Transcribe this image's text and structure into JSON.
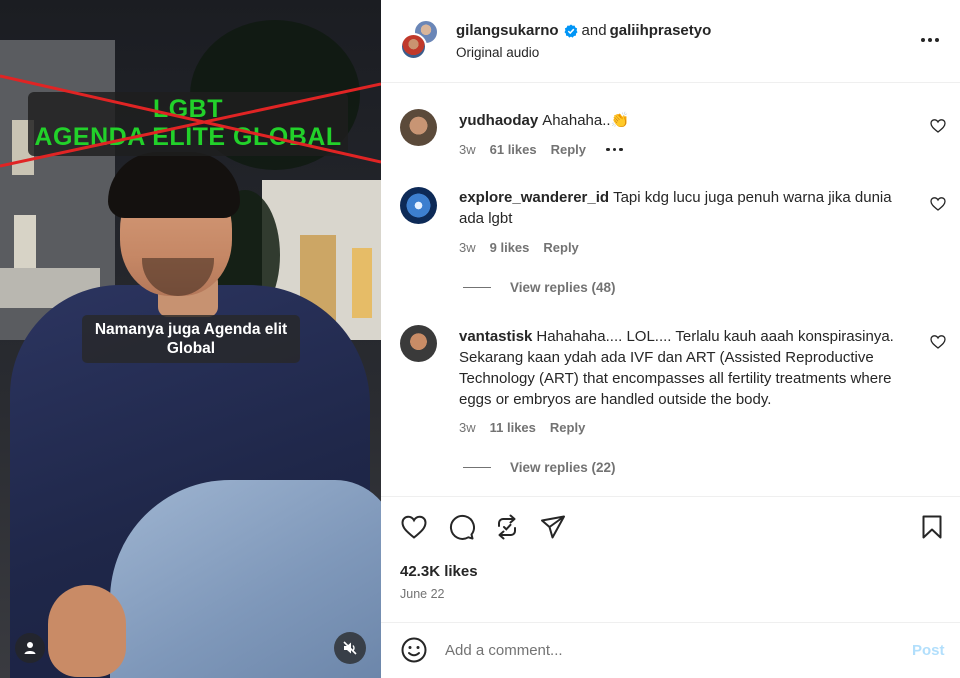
{
  "video": {
    "overlay_title_line1": "LGBT",
    "overlay_title_line2": "AGENDA ELITE GLOBAL",
    "caption": "Namanya juga Agenda elit Global"
  },
  "header": {
    "username_primary": "gilangsukarno",
    "connector": "and",
    "username_collab": "galiihprasetyo",
    "audio": "Original audio",
    "verified": true
  },
  "comments": [
    {
      "username": "yudhaoday",
      "text": "Ahahaha..👏",
      "time": "3w",
      "likes": "61 likes",
      "reply_label": "Reply"
    },
    {
      "username": "explore_wanderer_id",
      "text": "Tapi kdg lucu juga penuh warna jika dunia ada lgbt",
      "time": "3w",
      "likes": "9 likes",
      "reply_label": "Reply",
      "view_replies": "View replies (48)"
    },
    {
      "username": "vantastisk",
      "text": "Hahahaha.... LOL.... Terlalu kauh aaah konspirasinya. Sekarang kaan ydah ada IVF dan ART (Assisted Reproductive Technology (ART) that encompasses all fertility treatments where eggs or embryos are handled outside the body.",
      "time": "3w",
      "likes": "11 likes",
      "reply_label": "Reply",
      "view_replies": "View replies (22)"
    }
  ],
  "actions": {
    "likes": "42.3K likes",
    "date": "June 22"
  },
  "composer": {
    "placeholder": "Add a comment...",
    "post_label": "Post"
  },
  "colors": {
    "overlay_green": "#22d12a",
    "cross_red": "#e02424",
    "verified_blue": "#0095f6",
    "post_disabled": "#b2dffc"
  }
}
